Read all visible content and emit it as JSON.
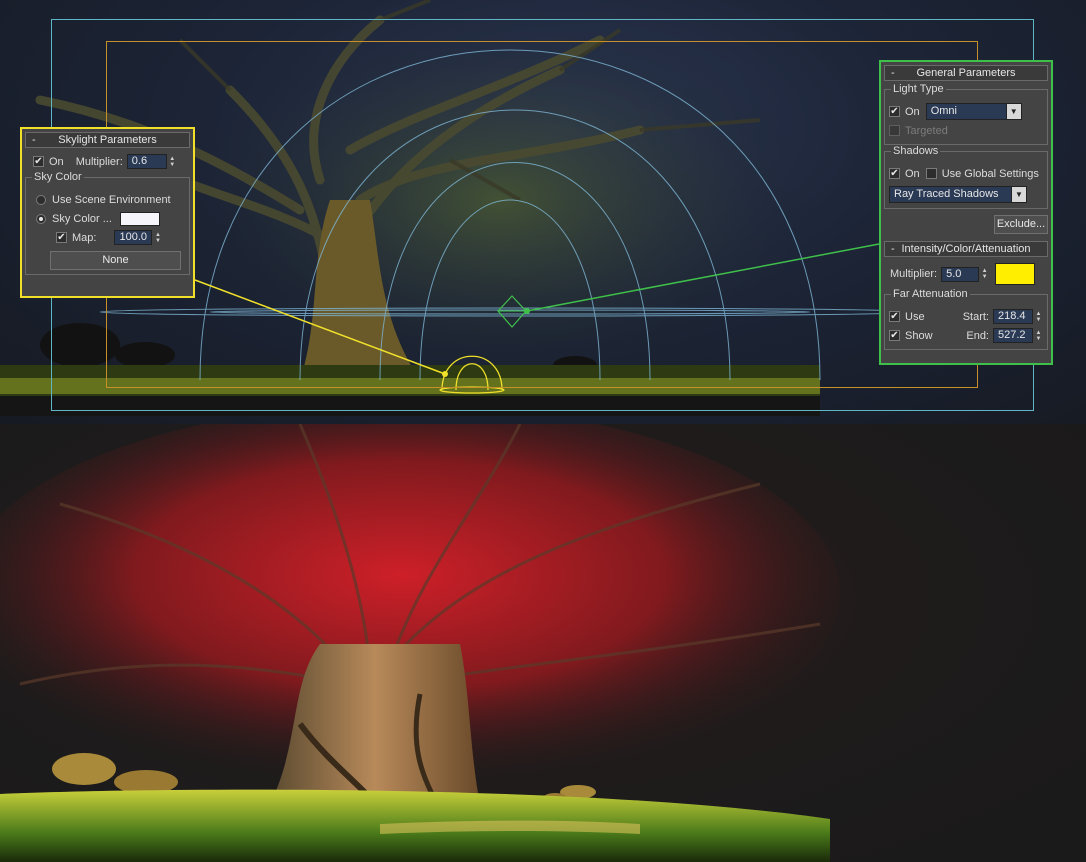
{
  "skylight": {
    "title": "Skylight Parameters",
    "collapse_symbol": "-",
    "on_label": "On",
    "on_checked": true,
    "multiplier_label": "Multiplier:",
    "multiplier_value": "0.6",
    "sky_color_group": "Sky Color",
    "use_scene_env_label": "Use Scene Environment",
    "sky_color_label": "Sky Color ...",
    "sky_color_swatch": "#f4f4fa",
    "map_label": "Map:",
    "map_checked": true,
    "map_value": "100.0",
    "map_button": "None",
    "border_color": "#f0e02a"
  },
  "general": {
    "title": "General Parameters",
    "collapse_symbol": "-",
    "light_type_group": "Light Type",
    "on_label": "On",
    "on_checked": true,
    "type_value": "Omni",
    "targeted_label": "Targeted",
    "shadows_group": "Shadows",
    "shadows_on_label": "On",
    "use_global_label": "Use Global Settings",
    "shadow_type": "Ray Traced Shadows",
    "exclude_button": "Exclude...",
    "border_color": "#3fc04a"
  },
  "intensity": {
    "title": "Intensity/Color/Attenuation",
    "collapse_symbol": "-",
    "multiplier_label": "Multiplier:",
    "multiplier_value": "5.0",
    "color_swatch": "#ffee00",
    "far_group": "Far Attenuation",
    "use_label": "Use",
    "show_label": "Show",
    "start_label": "Start:",
    "start_value": "218.4",
    "end_label": "End:",
    "end_value": "527.2"
  },
  "icons": {
    "check": "✔",
    "arrow_up": "▲",
    "arrow_down": "▼"
  }
}
